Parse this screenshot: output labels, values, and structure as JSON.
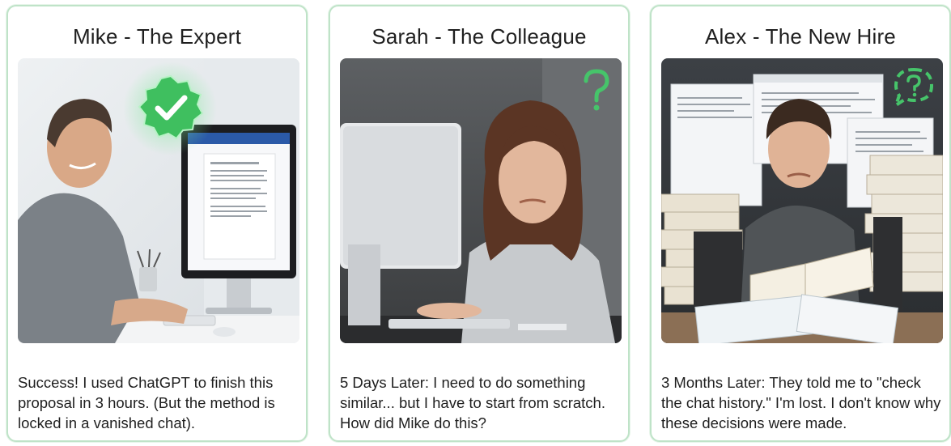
{
  "cards": [
    {
      "title": "Mike - The Expert",
      "caption": "Success! I used ChatGPT to finish this proposal in 3 hours. (But the method is locked in a vanished chat).",
      "badge_icon": "check-badge-icon"
    },
    {
      "title": "Sarah - The Colleague",
      "caption": "5 Days Later: I need to do something similar... but I have to start from scratch. How did Mike do this?",
      "badge_icon": "question-mark-icon"
    },
    {
      "title": "Alex - The New Hire",
      "caption": "3 Months Later: They told me to \"check the chat history.\" I'm lost. I don't know why these decisions were made.",
      "badge_icon": "chat-question-icon"
    }
  ],
  "colors": {
    "card_border": "#bfe3c8",
    "accent_green": "#3fbf5f",
    "text": "#1f1f1f"
  }
}
